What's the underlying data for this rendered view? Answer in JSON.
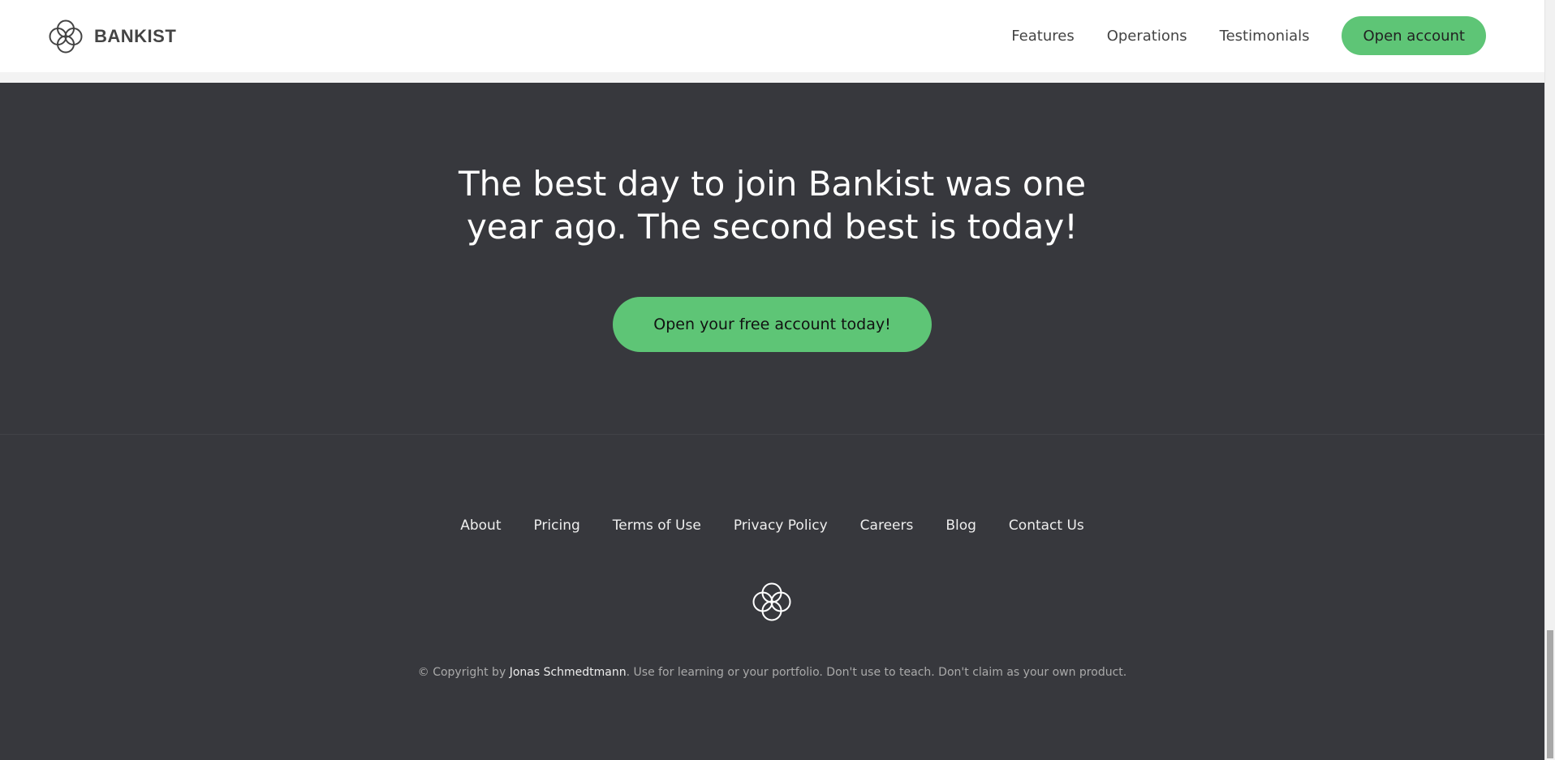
{
  "header": {
    "brand": "BANKIST",
    "nav": {
      "features": "Features",
      "operations": "Operations",
      "testimonials": "Testimonials",
      "open_account": "Open account"
    }
  },
  "cta": {
    "title_line1": "The best day to join Bankist was one",
    "title_line2": "year ago. The second best is today!",
    "button": "Open your free account today!"
  },
  "footer": {
    "links": {
      "about": "About",
      "pricing": "Pricing",
      "terms": "Terms of Use",
      "privacy": "Privacy Policy",
      "careers": "Careers",
      "blog": "Blog",
      "contact": "Contact Us"
    },
    "copyright_prefix": "© Copyright by ",
    "copyright_author": "Jonas Schmedtmann",
    "copyright_suffix": ". Use for learning or your portfolio. Don't use to teach. Don't claim as your own product."
  },
  "colors": {
    "accent": "#5ec576",
    "section_bg": "#37383d",
    "header_bg": "#ffffff"
  },
  "icons": {
    "logo": "bankist-logo-icon"
  }
}
